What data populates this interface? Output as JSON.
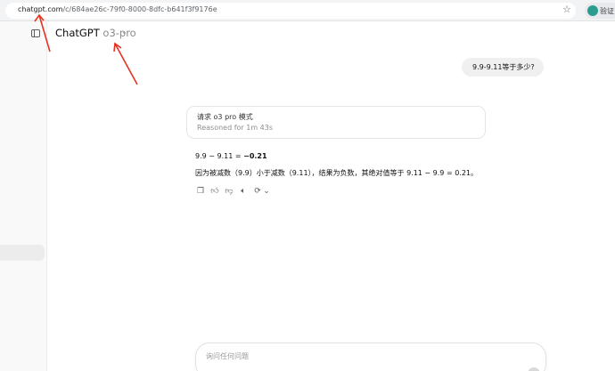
{
  "browser": {
    "url_host": "chatgpt.com",
    "url_path": "/c/684ae26c-79f0-8000-8dfc-b641f3f9176e",
    "profile_label": "验证"
  },
  "header": {
    "model_name": "ChatGPT",
    "model_variant": "o3-pro"
  },
  "conversation": {
    "user_message": "9.9-9.11等于多少?",
    "reasoning": {
      "title": "请求 o3 pro 模式",
      "duration": "Reasoned for 1m 43s"
    },
    "answer": {
      "equation": "9.9 − 9.11 = ",
      "result": "−0.21",
      "explanation": "因为被减数（9.9）小于减数（9.11），结果为负数，其绝对值等于 9.11 − 9.9 = 0.21。"
    }
  },
  "composer": {
    "placeholder": "询问任何问题"
  },
  "colors": {
    "annotation_arrow": "#e53323",
    "user_bubble": "#f0f0f0"
  }
}
